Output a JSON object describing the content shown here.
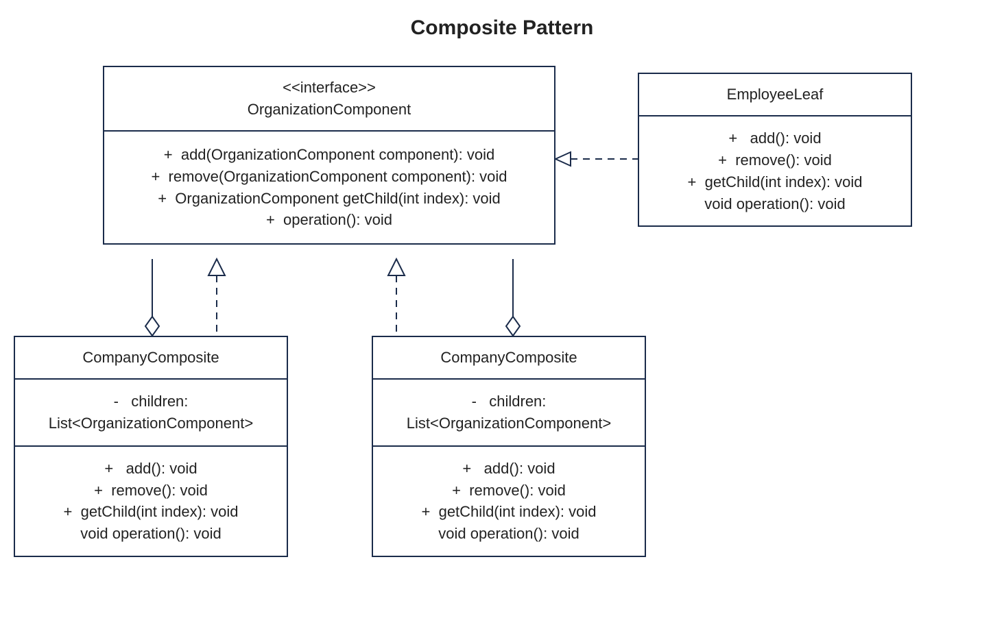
{
  "title": "Composite Pattern",
  "interface": {
    "stereotype": "<<interface>>",
    "name": "OrganizationComponent",
    "methods": [
      "+  add(OrganizationComponent component): void",
      "+  remove(OrganizationComponent component): void",
      "+  OrganizationComponent getChild(int index): void",
      "+  operation(): void"
    ]
  },
  "employeeLeaf": {
    "name": "EmployeeLeaf",
    "methods": [
      "+   add(): void",
      "+  remove(): void",
      "+  getChild(int index): void",
      "void operation(): void"
    ]
  },
  "compositeLeft": {
    "name": "CompanyComposite",
    "attributes": [
      "-   children:",
      "List<OrganizationComponent>"
    ],
    "methods": [
      "+   add(): void",
      "+  remove(): void",
      "+  getChild(int index): void",
      "void operation(): void"
    ]
  },
  "compositeRight": {
    "name": "CompanyComposite",
    "attributes": [
      "-   children:",
      "List<OrganizationComponent>"
    ],
    "methods": [
      "+   add(): void",
      "+  remove(): void",
      "+  getChild(int index): void",
      "void operation(): void"
    ]
  }
}
